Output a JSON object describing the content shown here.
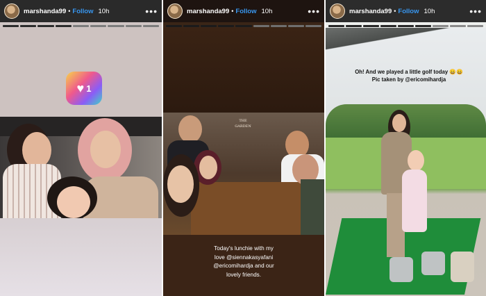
{
  "stories": [
    {
      "username": "marshanda99",
      "dot": "•",
      "follow_label": "Follow",
      "time": "10h",
      "more": "•••",
      "sticker": {
        "icon": "heart-icon",
        "count": "1"
      }
    },
    {
      "username": "marshanda99",
      "dot": "•",
      "follow_label": "Follow",
      "time": "10h",
      "more": "•••",
      "sign_text": "THE GARDEN",
      "caption": [
        "Today's lunchie with my",
        "love @siennakasyafani",
        "@ericomihardja and our",
        "lovely friends."
      ]
    },
    {
      "username": "marshanda99",
      "dot": "•",
      "follow_label": "Follow",
      "time": "10h",
      "more": "•••",
      "caption": [
        "Oh! And we played a little golf today 😄😄",
        "Pic taken by @ericomihardja"
      ]
    }
  ],
  "colors": {
    "follow": "#3897f0",
    "caption_dark": "#111111",
    "caption_light": "#ffffff"
  }
}
